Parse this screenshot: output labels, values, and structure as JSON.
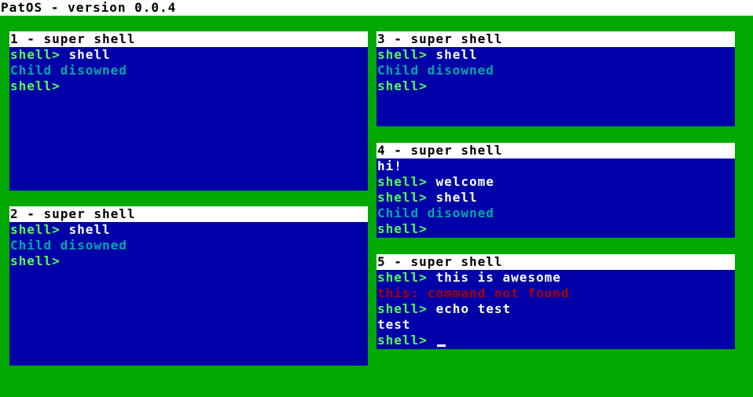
{
  "header": {
    "title": "PatOS - version 0.0.4"
  },
  "colors": {
    "desktop": "#00a800",
    "window_bg": "#0000a8",
    "title_bg": "#ffffff",
    "prompt": "#55ff55",
    "info": "#00a8a8",
    "error": "#a80000",
    "text": "#ffffff"
  },
  "windows": [
    {
      "title": "1 - super shell",
      "lines": [
        {
          "prompt": "shell> ",
          "text": "shell"
        },
        {
          "info": "Child disowned"
        },
        {
          "prompt": "shell>"
        }
      ]
    },
    {
      "title": "2 - super shell",
      "lines": [
        {
          "prompt": "shell> ",
          "text": "shell"
        },
        {
          "info": "Child disowned"
        },
        {
          "prompt": "shell>"
        }
      ]
    },
    {
      "title": "3 - super shell",
      "lines": [
        {
          "prompt": "shell> ",
          "text": "shell"
        },
        {
          "info": "Child disowned"
        },
        {
          "prompt": "shell>"
        }
      ]
    },
    {
      "title": "4 - super shell",
      "lines": [
        {
          "plain": "hi!"
        },
        {
          "prompt": "shell> ",
          "text": "welcome"
        },
        {
          "prompt": "shell> ",
          "text": "shell"
        },
        {
          "info": "Child disowned"
        },
        {
          "prompt": "shell>"
        }
      ]
    },
    {
      "title": "5 - super shell",
      "lines": [
        {
          "prompt": "shell> ",
          "text": "this is awesome"
        },
        {
          "error": "this: command not found"
        },
        {
          "prompt": "shell> ",
          "text": "echo test"
        },
        {
          "plain": "test"
        },
        {
          "prompt": "shell> "
        }
      ]
    }
  ]
}
